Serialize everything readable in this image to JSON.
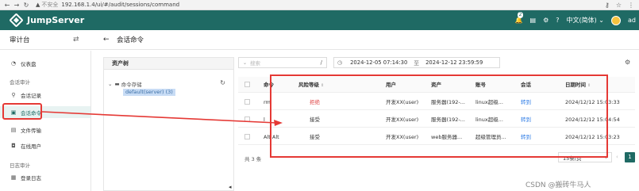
{
  "browser": {
    "security_label": "不安全",
    "url": "192.168.1.4/ui/#/audit/sessions/command"
  },
  "header": {
    "app_name": "JumpServer",
    "notification_count": "2",
    "language": "中文(简体)",
    "user_label": "ad",
    "brand_color": "#1f6a64"
  },
  "subheader": {
    "console_title": "审计台",
    "page_title": "会话命令"
  },
  "sidebar": {
    "items_top": [
      {
        "label": "仪表盘",
        "icon": "dashboard-icon"
      }
    ],
    "group_session": "会话审计",
    "items_session": [
      {
        "label": "会话记录",
        "icon": "link-icon"
      },
      {
        "label": "会话命令",
        "icon": "terminal-icon"
      },
      {
        "label": "文件传输",
        "icon": "file-icon"
      },
      {
        "label": "在线用户",
        "icon": "user-icon"
      }
    ],
    "group_log": "日志审计",
    "items_log": [
      {
        "label": "登录日志",
        "icon": "login-icon"
      }
    ]
  },
  "tree": {
    "title": "资产树",
    "root_label": "命令存储",
    "child_label": "default(server) (3)"
  },
  "toolbar": {
    "search_placeholder": "搜索",
    "start_date": "2024-12-05 07:14:30",
    "date_separator": "至",
    "end_date": "2024-12-12 23:59:59"
  },
  "table": {
    "headers": [
      "命令",
      "风险等级",
      "用户",
      "资产",
      "账号",
      "会话",
      "日期时间"
    ],
    "rows": [
      {
        "command": "rm",
        "risk": "拒绝",
        "user": "开发XX(user)",
        "asset": "服务器(192-...",
        "account": "linux超级...",
        "session": "转到",
        "datetime": "2024/12/12 15:03:33"
      },
      {
        "command": "l",
        "risk": "接受",
        "user": "开发XX(user)",
        "asset": "服务器(192-...",
        "account": "linux超级...",
        "session": "转到",
        "datetime": "2024/12/12 15:04:54"
      },
      {
        "command": "Alt Alt",
        "risk": "接受",
        "user": "开发XX(user)",
        "asset": "web服务器...",
        "account": "超级管理员...",
        "session": "转到",
        "datetime": "2024/12/12 15:03:23"
      }
    ]
  },
  "pagination": {
    "total": "共 3 条",
    "page_size": "15条/页",
    "current_page": "1"
  },
  "watermark": "CSDN @搬砖牛马人"
}
